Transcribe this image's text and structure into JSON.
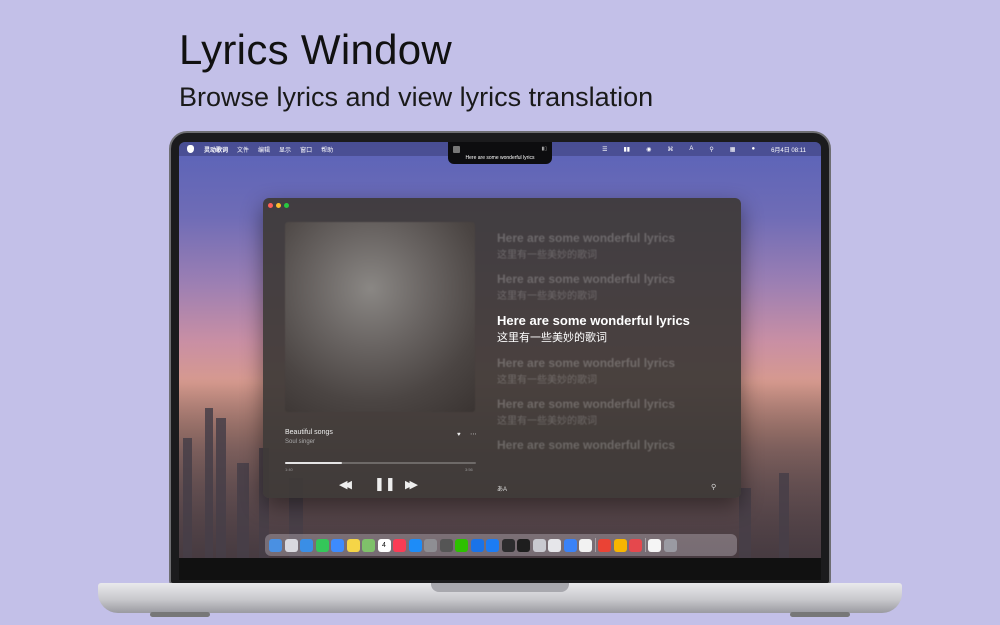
{
  "headline": "Lyrics Window",
  "subheadline": "Browse lyrics and view lyrics translation",
  "menubar": {
    "app_name": "灵动歌词",
    "menus": [
      "文件",
      "编辑",
      "显示",
      "窗口",
      "帮助"
    ],
    "date_time": "6月4日  08:11"
  },
  "notch": {
    "current_lyric": "Here are some wonderful lyrics"
  },
  "player": {
    "track_title": "Beautiful songs",
    "artist": "Soul singer",
    "time_elapsed": "1:40",
    "time_total": "3:56",
    "progress_fraction": 0.3,
    "icons": {
      "like": "heart-icon",
      "more": "ellipsis-icon",
      "previous": "rewind-icon",
      "play_pause": "pause-icon",
      "next": "fast-forward-icon",
      "translate": "translate-icon",
      "search": "search-icon"
    }
  },
  "lyrics": [
    {
      "en": "Here are some wonderful lyrics",
      "zh": "这里有一些美妙的歌词",
      "active": false
    },
    {
      "en": "Here are some wonderful lyrics",
      "zh": "这里有一些美妙的歌词",
      "active": false
    },
    {
      "en": "Here are some wonderful lyrics",
      "zh": "这里有一些美妙的歌词",
      "active": true
    },
    {
      "en": "Here are some wonderful lyrics",
      "zh": "这里有一些美妙的歌词",
      "active": false
    },
    {
      "en": "Here are some wonderful lyrics",
      "zh": "这里有一些美妙的歌词",
      "active": false
    },
    {
      "en": "Here are some wonderful lyrics",
      "zh": "",
      "active": false
    }
  ],
  "dock": {
    "apps": [
      {
        "name": "finder",
        "color": "#4a90e2"
      },
      {
        "name": "launchpad",
        "color": "#d9d9e0"
      },
      {
        "name": "safari",
        "color": "#3a8ee6"
      },
      {
        "name": "messages",
        "color": "#34c759"
      },
      {
        "name": "mail",
        "color": "#3d8bfd"
      },
      {
        "name": "notes",
        "color": "#f5d547"
      },
      {
        "name": "maps",
        "color": "#7fc16a"
      },
      {
        "name": "calendar",
        "color": "#ffffff"
      },
      {
        "name": "music",
        "color": "#fa3c55"
      },
      {
        "name": "app-store",
        "color": "#1d8cf8"
      },
      {
        "name": "system-settings",
        "color": "#8e8e93"
      },
      {
        "name": "calculator",
        "color": "#555555"
      },
      {
        "name": "wechat",
        "color": "#2dc100"
      },
      {
        "name": "location",
        "color": "#1a73e8"
      },
      {
        "name": "xcode",
        "color": "#1c7cf4"
      },
      {
        "name": "scripts",
        "color": "#2c2c2e"
      },
      {
        "name": "terminal",
        "color": "#1e1e1e"
      },
      {
        "name": "preview",
        "color": "#c9c9d0"
      },
      {
        "name": "photo-app",
        "color": "#e6e6ea"
      },
      {
        "name": "screenshot",
        "color": "#3b82f6"
      },
      {
        "name": "activity",
        "color": "#f2f2f2"
      },
      {
        "name": "chrome",
        "color": "#ea4335"
      },
      {
        "name": "sketch",
        "color": "#f7b500"
      },
      {
        "name": "todo",
        "color": "#e5484d"
      },
      {
        "name": "document",
        "color": "#f5f5f5"
      },
      {
        "name": "trash",
        "color": "#9a9aa2"
      }
    ],
    "separator_after": [
      20,
      23
    ],
    "calendar_day": "4"
  },
  "colors": {
    "page_background": "#c3c0e8",
    "window_background": "#3e3a38",
    "active_lyric": "#ffffff"
  }
}
